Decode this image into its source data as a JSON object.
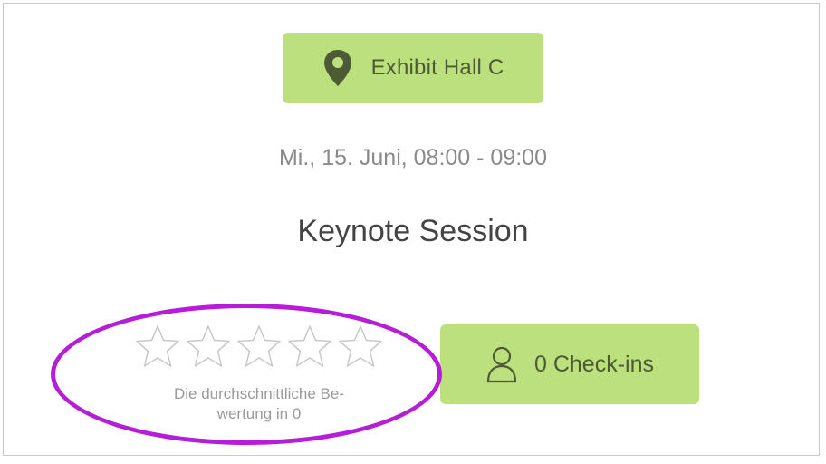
{
  "location": {
    "label": "Exhibit Hall C",
    "icon": "map-pin-icon"
  },
  "session": {
    "datetime": "Mi., 15. Juni, 08:00 - 09:00",
    "title": "Keynote Session"
  },
  "rating": {
    "stars_total": 5,
    "stars_filled": 0,
    "line1": "Die durchschnittliche Be-",
    "line2": "wertung in 0"
  },
  "checkins": {
    "label": "0 Check-ins",
    "icon": "person-icon"
  },
  "colors": {
    "button_bg": "#bde07f",
    "icon_dark": "#4c5a36",
    "highlight": "#b51ed6",
    "star_outline": "#c8c8c8"
  }
}
